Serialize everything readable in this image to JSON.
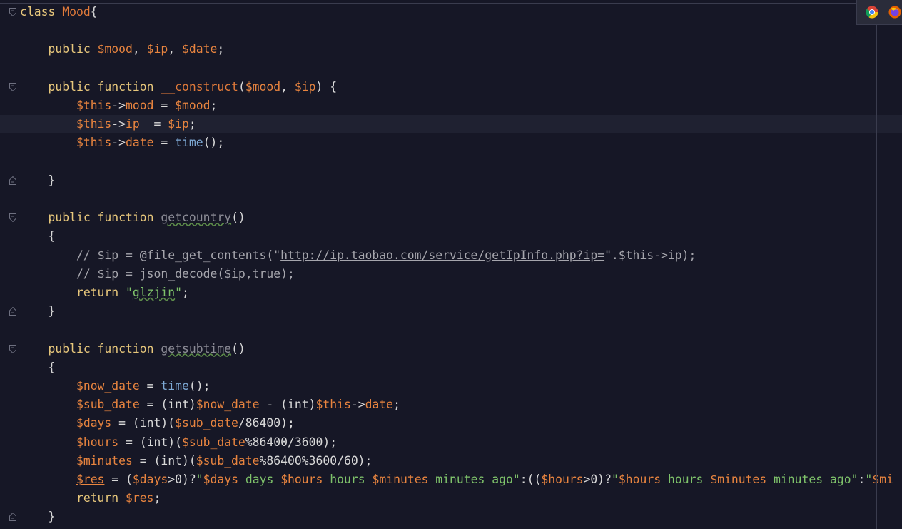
{
  "editor": {
    "lines": [
      [
        [
          "kw",
          "class "
        ],
        [
          "cls",
          "Mood"
        ],
        [
          "op",
          "{"
        ]
      ],
      [],
      [
        [
          "op",
          "    "
        ],
        [
          "kw",
          "public "
        ],
        [
          "var",
          "$mood"
        ],
        [
          "op",
          ", "
        ],
        [
          "var",
          "$ip"
        ],
        [
          "op",
          ", "
        ],
        [
          "var",
          "$date"
        ],
        [
          "op",
          ";"
        ]
      ],
      [],
      [
        [
          "op",
          "    "
        ],
        [
          "kw",
          "public function "
        ],
        [
          "fn2",
          "__construct"
        ],
        [
          "op",
          "("
        ],
        [
          "var",
          "$mood"
        ],
        [
          "op",
          ", "
        ],
        [
          "var",
          "$ip"
        ],
        [
          "op",
          ") {"
        ]
      ],
      [
        [
          "op",
          "        "
        ],
        [
          "var",
          "$this"
        ],
        [
          "op",
          "->"
        ],
        [
          "var",
          "mood"
        ],
        [
          "op",
          " = "
        ],
        [
          "var",
          "$mood"
        ],
        [
          "op",
          ";"
        ]
      ],
      [
        [
          "op",
          "        "
        ],
        [
          "var",
          "$this"
        ],
        [
          "op",
          "->"
        ],
        [
          "var",
          "ip"
        ],
        [
          "op",
          "  = "
        ],
        [
          "var",
          "$ip"
        ],
        [
          "op",
          ";"
        ]
      ],
      [
        [
          "op",
          "        "
        ],
        [
          "var",
          "$this"
        ],
        [
          "op",
          "->"
        ],
        [
          "var",
          "date"
        ],
        [
          "op",
          " = "
        ],
        [
          "fn",
          "time"
        ],
        [
          "op",
          "();"
        ]
      ],
      [],
      [
        [
          "op",
          "    }"
        ]
      ],
      [],
      [
        [
          "op",
          "    "
        ],
        [
          "kw",
          "public function "
        ],
        [
          "unused",
          "getcountry"
        ],
        [
          "op",
          "()"
        ]
      ],
      [
        [
          "op",
          "    {"
        ]
      ],
      [
        [
          "op",
          "        "
        ],
        [
          "cmt",
          "// $ip = @file_get_contents(\""
        ],
        [
          "link",
          "http://ip.taobao.com/service/getIpInfo.php?ip="
        ],
        [
          "cmt",
          "\".$this->ip);"
        ]
      ],
      [
        [
          "op",
          "        "
        ],
        [
          "cmt",
          "// $ip = json_decode($ip,true);"
        ]
      ],
      [
        [
          "op",
          "        "
        ],
        [
          "kw",
          "return "
        ],
        [
          "str",
          "\""
        ],
        [
          "strtypo",
          "glzjin"
        ],
        [
          "str",
          "\""
        ],
        [
          "op",
          ";"
        ]
      ],
      [
        [
          "op",
          "    }"
        ]
      ],
      [],
      [
        [
          "op",
          "    "
        ],
        [
          "kw",
          "public function "
        ],
        [
          "unused",
          "getsubtime"
        ],
        [
          "op",
          "()"
        ]
      ],
      [
        [
          "op",
          "    {"
        ]
      ],
      [
        [
          "op",
          "        "
        ],
        [
          "var",
          "$now_date"
        ],
        [
          "op",
          " = "
        ],
        [
          "fn",
          "time"
        ],
        [
          "op",
          "();"
        ]
      ],
      [
        [
          "op",
          "        "
        ],
        [
          "var",
          "$sub_date"
        ],
        [
          "op",
          " = (int)"
        ],
        [
          "var",
          "$now_date"
        ],
        [
          "op",
          " - (int)"
        ],
        [
          "var",
          "$this"
        ],
        [
          "op",
          "->"
        ],
        [
          "var",
          "date"
        ],
        [
          "op",
          ";"
        ]
      ],
      [
        [
          "op",
          "        "
        ],
        [
          "var",
          "$days"
        ],
        [
          "op",
          " = (int)("
        ],
        [
          "var",
          "$sub_date"
        ],
        [
          "op",
          "/86400);"
        ]
      ],
      [
        [
          "op",
          "        "
        ],
        [
          "var",
          "$hours"
        ],
        [
          "op",
          " = (int)("
        ],
        [
          "var",
          "$sub_date"
        ],
        [
          "op",
          "%86400/3600);"
        ]
      ],
      [
        [
          "op",
          "        "
        ],
        [
          "var",
          "$minutes"
        ],
        [
          "op",
          " = (int)("
        ],
        [
          "var",
          "$sub_date"
        ],
        [
          "op",
          "%86400%3600/60);"
        ]
      ],
      [
        [
          "op",
          "        "
        ],
        [
          "var-u",
          "$res"
        ],
        [
          "op",
          " = ("
        ],
        [
          "var",
          "$days"
        ],
        [
          "op",
          ">0)?"
        ],
        [
          "str",
          "\""
        ],
        [
          "var",
          "$days"
        ],
        [
          "str",
          " days "
        ],
        [
          "var",
          "$hours"
        ],
        [
          "str",
          " hours "
        ],
        [
          "var",
          "$minutes"
        ],
        [
          "str",
          " minutes ago\""
        ],
        [
          "op",
          ":(("
        ],
        [
          "var",
          "$hours"
        ],
        [
          "op",
          ">0)?"
        ],
        [
          "str",
          "\""
        ],
        [
          "var",
          "$hours"
        ],
        [
          "str",
          " hours "
        ],
        [
          "var",
          "$minutes"
        ],
        [
          "str",
          " minutes ago\""
        ],
        [
          "op",
          ":"
        ],
        [
          "str",
          "\""
        ],
        [
          "var",
          "$mi"
        ]
      ],
      [
        [
          "op",
          "        "
        ],
        [
          "kw",
          "return "
        ],
        [
          "var",
          "$res"
        ],
        [
          "op",
          ";"
        ]
      ],
      [
        [
          "op",
          "    }"
        ]
      ]
    ],
    "gutter_marks": [
      {
        "line": 0,
        "kind": "open"
      },
      {
        "line": 4,
        "kind": "open"
      },
      {
        "line": 9,
        "kind": "close"
      },
      {
        "line": 11,
        "kind": "open"
      },
      {
        "line": 16,
        "kind": "close"
      },
      {
        "line": 18,
        "kind": "open"
      },
      {
        "line": 27,
        "kind": "close"
      }
    ],
    "current_line": 6
  },
  "browser_icons": [
    "chrome-icon",
    "firefox-icon"
  ]
}
